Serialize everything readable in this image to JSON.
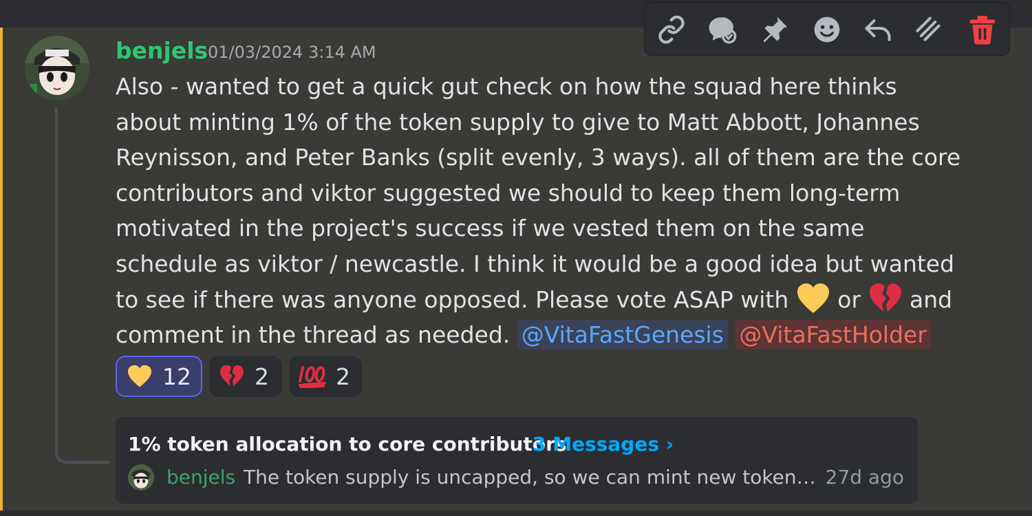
{
  "message": {
    "author": "benjels",
    "timestamp": "01/03/2024 3:14 AM",
    "text_before_heart": "Also - wanted to get a quick gut check on how the squad here thinks about minting 1% of the token supply to give to Matt Abbott, Johannes Reynisson, and Peter Banks (split evenly, 3 ways). all of them are the core contributors and viktor suggested we should to keep them long-term motivated in the project's success if we vested them on the same schedule as viktor / newcastle. I think it would be a good idea but wanted to see if there was anyone opposed. Please vote ASAP with ",
    "text_between": " or ",
    "text_after": " and comment in the thread as needed. ",
    "mentions": [
      "@VitaFastGenesis",
      "@VitaFastHolder"
    ],
    "inline_emoji": [
      "yellow-heart",
      "broken-heart"
    ]
  },
  "reactions": [
    {
      "emoji": "yellow-heart",
      "count": "12",
      "active": true
    },
    {
      "emoji": "broken-heart",
      "count": "2",
      "active": false
    },
    {
      "emoji": "hundred-points",
      "count": "2",
      "active": false
    }
  ],
  "thread": {
    "title": "1% token allocation to core contributors",
    "message_count": "3 Messages ›",
    "last_author": "benjels",
    "last_message": "The token supply is uncapped, so we can mint new tokens to give people stuff",
    "age": "27d ago"
  },
  "toolbar": {
    "buttons": [
      "link-icon",
      "thread-reply-icon",
      "pin-icon",
      "add-reaction-icon",
      "reply-icon",
      "more-stack-icon",
      "delete-icon"
    ]
  },
  "colors": {
    "accent_left_bar": "#f0b232",
    "username": "#2dc770",
    "mention_blue": "#58a6ff",
    "mention_red": "#f26c5e",
    "thread_link": "#00a8fc",
    "delete": "#f23f43"
  }
}
